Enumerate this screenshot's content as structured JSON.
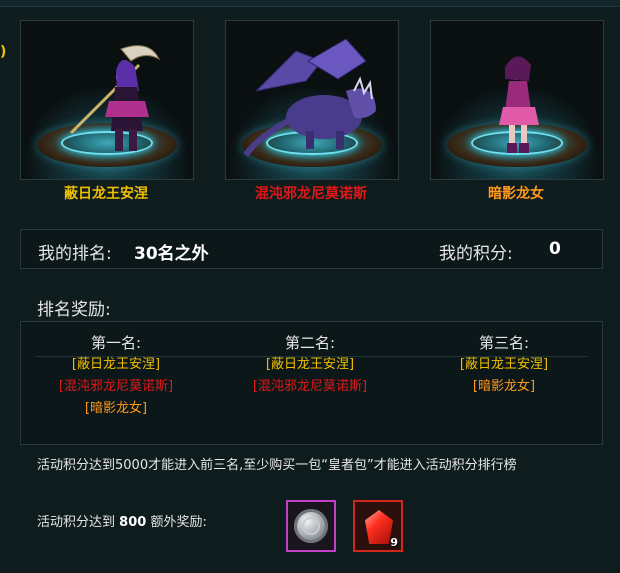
{
  "left_fragment": ")",
  "heroes": [
    {
      "name": "蔽日龙王安涅",
      "color": "#f0c000"
    },
    {
      "name": "混沌邪龙尼莫诺斯",
      "color": "#e01818"
    },
    {
      "name": "暗影龙女",
      "color": "#ff9a1a"
    }
  ],
  "my_rank": {
    "label": "我的排名:",
    "value": "30名之外"
  },
  "my_score": {
    "label": "我的积分:",
    "value": "0"
  },
  "rank_rewards": {
    "title": "排名奖励:",
    "columns": [
      {
        "header": "第一名:",
        "items": [
          "[蔽日龙王安涅]",
          "[混沌邪龙尼莫诺斯]",
          "[暗影龙女]"
        ]
      },
      {
        "header": "第二名:",
        "items": [
          "[蔽日龙王安涅]",
          "[混沌邪龙尼莫诺斯]"
        ]
      },
      {
        "header": "第三名:",
        "items": [
          "[蔽日龙王安涅]",
          "[暗影龙女]"
        ]
      }
    ]
  },
  "note": "活动积分达到5000才能进入前三名,至少购买一包“皇者包”才能进入活动积分排行榜",
  "bonus": {
    "prefix": "活动积分达到",
    "threshold": "800",
    "suffix": "额外奖励:"
  },
  "bonus_items": [
    {
      "icon": "silver-coin-icon",
      "count": ""
    },
    {
      "icon": "red-crystal-icon",
      "count": "9"
    }
  ]
}
